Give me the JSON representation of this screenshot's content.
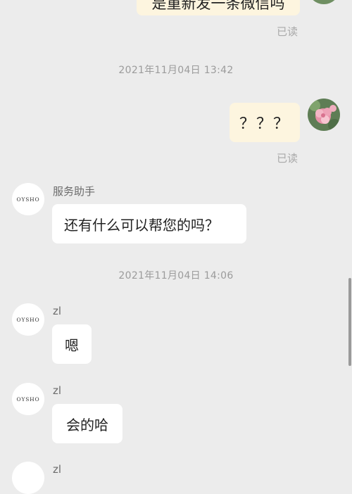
{
  "messages": {
    "m1": {
      "text": "是重新发一条微信吗",
      "status": "已读"
    },
    "t1": "2021年11月04日 13:42",
    "m2": {
      "text": "？？？",
      "status": "已读"
    },
    "m3": {
      "sender": "服务助手",
      "text": "还有什么可以帮您的吗？",
      "avatar_text": "OYSHO"
    },
    "t2": "2021年11月04日 14:06",
    "m4": {
      "sender": "zl",
      "text": "嗯",
      "avatar_text": "OYSHO"
    },
    "m5": {
      "sender": "zl",
      "text": "会的哈",
      "avatar_text": "OYSHO"
    },
    "m6": {
      "sender": "zl"
    }
  },
  "colors": {
    "background": "#ececec",
    "outgoing_bubble": "#fdf5df",
    "incoming_bubble": "#ffffff"
  }
}
